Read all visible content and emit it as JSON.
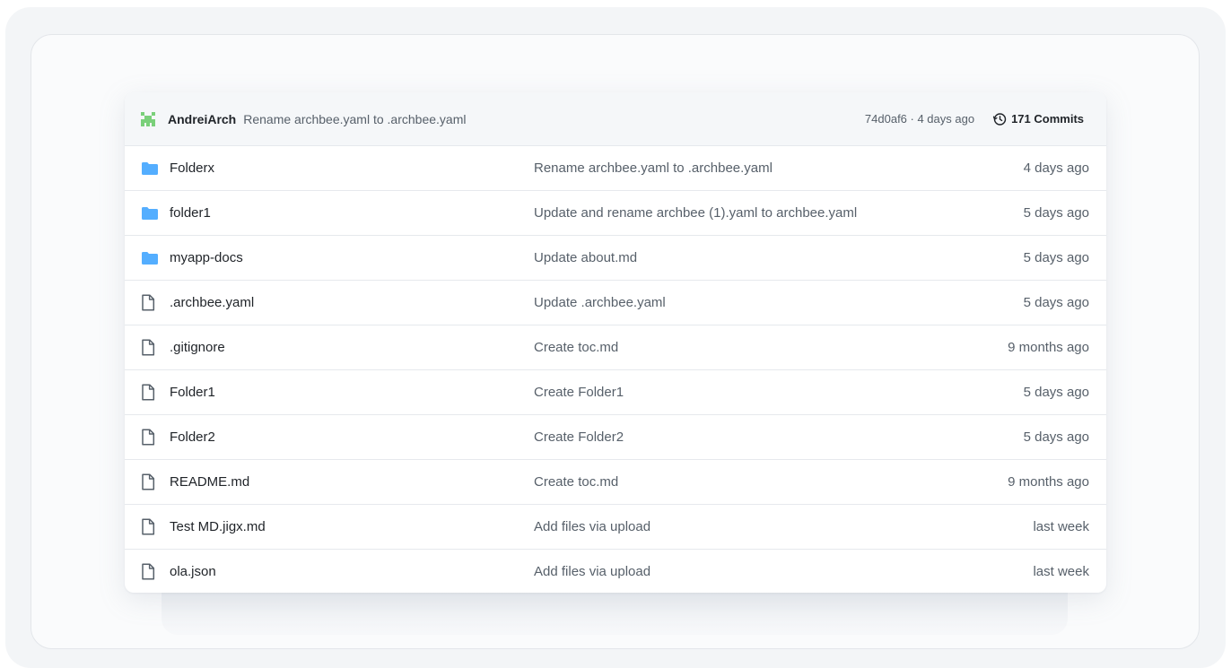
{
  "colors": {
    "folder": "#54aeff",
    "file": "#57606a",
    "avatar": "#7ad07a"
  },
  "latest_commit": {
    "author": "AndreiArch",
    "message": "Rename archbee.yaml to .archbee.yaml",
    "meta": "74d0af6 · 4 days ago",
    "commits_label": "171 Commits",
    "avatar_icon": "identicon-avatar",
    "history_icon": "history-icon"
  },
  "entries": [
    {
      "type": "folder",
      "icon": "folder-icon",
      "name": "Folderx",
      "message": "Rename archbee.yaml to .archbee.yaml",
      "date": "4 days ago"
    },
    {
      "type": "folder",
      "icon": "folder-icon",
      "name": "folder1",
      "message": "Update and rename archbee (1).yaml to archbee.yaml",
      "date": "5 days ago"
    },
    {
      "type": "folder",
      "icon": "folder-icon",
      "name": "myapp-docs",
      "message": "Update about.md",
      "date": "5 days ago"
    },
    {
      "type": "file",
      "icon": "file-icon",
      "name": ".archbee.yaml",
      "message": "Update .archbee.yaml",
      "date": "5 days ago"
    },
    {
      "type": "file",
      "icon": "file-icon",
      "name": ".gitignore",
      "message": "Create toc.md",
      "date": "9 months ago"
    },
    {
      "type": "file",
      "icon": "file-icon",
      "name": "Folder1",
      "message": "Create Folder1",
      "date": "5 days ago"
    },
    {
      "type": "file",
      "icon": "file-icon",
      "name": "Folder2",
      "message": "Create Folder2",
      "date": "5 days ago"
    },
    {
      "type": "file",
      "icon": "file-icon",
      "name": "README.md",
      "message": "Create toc.md",
      "date": "9 months ago"
    },
    {
      "type": "file",
      "icon": "file-icon",
      "name": "Test MD.jigx.md",
      "message": "Add files via upload",
      "date": "last week"
    },
    {
      "type": "file",
      "icon": "file-icon",
      "name": "ola.json",
      "message": "Add files via upload",
      "date": "last week"
    }
  ]
}
